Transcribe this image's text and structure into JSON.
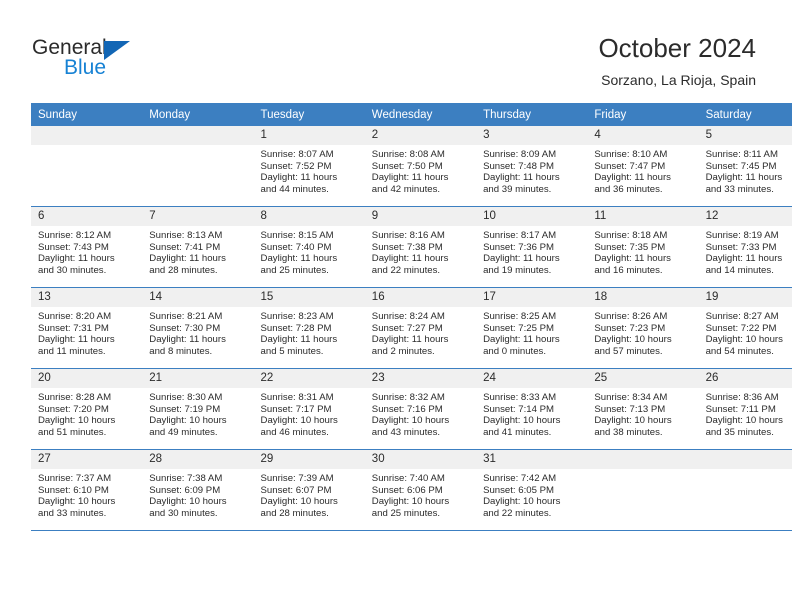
{
  "brand": {
    "name_top": "General",
    "name_bottom": "Blue",
    "accent_color": "#1782d4",
    "triangle_color": "#1266b5"
  },
  "header": {
    "title": "October 2024",
    "subtitle": "Sorzano, La Rioja, Spain"
  },
  "calendar": {
    "header_bg": "#3c7fc1",
    "daynum_bg": "#f0f0f0",
    "weekday_headers": [
      "Sunday",
      "Monday",
      "Tuesday",
      "Wednesday",
      "Thursday",
      "Friday",
      "Saturday"
    ],
    "weeks": [
      [
        {
          "day": "",
          "sunrise": "",
          "sunset": "",
          "daylight": "",
          "daylight2": ""
        },
        {
          "day": "",
          "sunrise": "",
          "sunset": "",
          "daylight": "",
          "daylight2": ""
        },
        {
          "day": "1",
          "sunrise": "Sunrise: 8:07 AM",
          "sunset": "Sunset: 7:52 PM",
          "daylight": "Daylight: 11 hours",
          "daylight2": "and 44 minutes."
        },
        {
          "day": "2",
          "sunrise": "Sunrise: 8:08 AM",
          "sunset": "Sunset: 7:50 PM",
          "daylight": "Daylight: 11 hours",
          "daylight2": "and 42 minutes."
        },
        {
          "day": "3",
          "sunrise": "Sunrise: 8:09 AM",
          "sunset": "Sunset: 7:48 PM",
          "daylight": "Daylight: 11 hours",
          "daylight2": "and 39 minutes."
        },
        {
          "day": "4",
          "sunrise": "Sunrise: 8:10 AM",
          "sunset": "Sunset: 7:47 PM",
          "daylight": "Daylight: 11 hours",
          "daylight2": "and 36 minutes."
        },
        {
          "day": "5",
          "sunrise": "Sunrise: 8:11 AM",
          "sunset": "Sunset: 7:45 PM",
          "daylight": "Daylight: 11 hours",
          "daylight2": "and 33 minutes."
        }
      ],
      [
        {
          "day": "6",
          "sunrise": "Sunrise: 8:12 AM",
          "sunset": "Sunset: 7:43 PM",
          "daylight": "Daylight: 11 hours",
          "daylight2": "and 30 minutes."
        },
        {
          "day": "7",
          "sunrise": "Sunrise: 8:13 AM",
          "sunset": "Sunset: 7:41 PM",
          "daylight": "Daylight: 11 hours",
          "daylight2": "and 28 minutes."
        },
        {
          "day": "8",
          "sunrise": "Sunrise: 8:15 AM",
          "sunset": "Sunset: 7:40 PM",
          "daylight": "Daylight: 11 hours",
          "daylight2": "and 25 minutes."
        },
        {
          "day": "9",
          "sunrise": "Sunrise: 8:16 AM",
          "sunset": "Sunset: 7:38 PM",
          "daylight": "Daylight: 11 hours",
          "daylight2": "and 22 minutes."
        },
        {
          "day": "10",
          "sunrise": "Sunrise: 8:17 AM",
          "sunset": "Sunset: 7:36 PM",
          "daylight": "Daylight: 11 hours",
          "daylight2": "and 19 minutes."
        },
        {
          "day": "11",
          "sunrise": "Sunrise: 8:18 AM",
          "sunset": "Sunset: 7:35 PM",
          "daylight": "Daylight: 11 hours",
          "daylight2": "and 16 minutes."
        },
        {
          "day": "12",
          "sunrise": "Sunrise: 8:19 AM",
          "sunset": "Sunset: 7:33 PM",
          "daylight": "Daylight: 11 hours",
          "daylight2": "and 14 minutes."
        }
      ],
      [
        {
          "day": "13",
          "sunrise": "Sunrise: 8:20 AM",
          "sunset": "Sunset: 7:31 PM",
          "daylight": "Daylight: 11 hours",
          "daylight2": "and 11 minutes."
        },
        {
          "day": "14",
          "sunrise": "Sunrise: 8:21 AM",
          "sunset": "Sunset: 7:30 PM",
          "daylight": "Daylight: 11 hours",
          "daylight2": "and 8 minutes."
        },
        {
          "day": "15",
          "sunrise": "Sunrise: 8:23 AM",
          "sunset": "Sunset: 7:28 PM",
          "daylight": "Daylight: 11 hours",
          "daylight2": "and 5 minutes."
        },
        {
          "day": "16",
          "sunrise": "Sunrise: 8:24 AM",
          "sunset": "Sunset: 7:27 PM",
          "daylight": "Daylight: 11 hours",
          "daylight2": "and 2 minutes."
        },
        {
          "day": "17",
          "sunrise": "Sunrise: 8:25 AM",
          "sunset": "Sunset: 7:25 PM",
          "daylight": "Daylight: 11 hours",
          "daylight2": "and 0 minutes."
        },
        {
          "day": "18",
          "sunrise": "Sunrise: 8:26 AM",
          "sunset": "Sunset: 7:23 PM",
          "daylight": "Daylight: 10 hours",
          "daylight2": "and 57 minutes."
        },
        {
          "day": "19",
          "sunrise": "Sunrise: 8:27 AM",
          "sunset": "Sunset: 7:22 PM",
          "daylight": "Daylight: 10 hours",
          "daylight2": "and 54 minutes."
        }
      ],
      [
        {
          "day": "20",
          "sunrise": "Sunrise: 8:28 AM",
          "sunset": "Sunset: 7:20 PM",
          "daylight": "Daylight: 10 hours",
          "daylight2": "and 51 minutes."
        },
        {
          "day": "21",
          "sunrise": "Sunrise: 8:30 AM",
          "sunset": "Sunset: 7:19 PM",
          "daylight": "Daylight: 10 hours",
          "daylight2": "and 49 minutes."
        },
        {
          "day": "22",
          "sunrise": "Sunrise: 8:31 AM",
          "sunset": "Sunset: 7:17 PM",
          "daylight": "Daylight: 10 hours",
          "daylight2": "and 46 minutes."
        },
        {
          "day": "23",
          "sunrise": "Sunrise: 8:32 AM",
          "sunset": "Sunset: 7:16 PM",
          "daylight": "Daylight: 10 hours",
          "daylight2": "and 43 minutes."
        },
        {
          "day": "24",
          "sunrise": "Sunrise: 8:33 AM",
          "sunset": "Sunset: 7:14 PM",
          "daylight": "Daylight: 10 hours",
          "daylight2": "and 41 minutes."
        },
        {
          "day": "25",
          "sunrise": "Sunrise: 8:34 AM",
          "sunset": "Sunset: 7:13 PM",
          "daylight": "Daylight: 10 hours",
          "daylight2": "and 38 minutes."
        },
        {
          "day": "26",
          "sunrise": "Sunrise: 8:36 AM",
          "sunset": "Sunset: 7:11 PM",
          "daylight": "Daylight: 10 hours",
          "daylight2": "and 35 minutes."
        }
      ],
      [
        {
          "day": "27",
          "sunrise": "Sunrise: 7:37 AM",
          "sunset": "Sunset: 6:10 PM",
          "daylight": "Daylight: 10 hours",
          "daylight2": "and 33 minutes."
        },
        {
          "day": "28",
          "sunrise": "Sunrise: 7:38 AM",
          "sunset": "Sunset: 6:09 PM",
          "daylight": "Daylight: 10 hours",
          "daylight2": "and 30 minutes."
        },
        {
          "day": "29",
          "sunrise": "Sunrise: 7:39 AM",
          "sunset": "Sunset: 6:07 PM",
          "daylight": "Daylight: 10 hours",
          "daylight2": "and 28 minutes."
        },
        {
          "day": "30",
          "sunrise": "Sunrise: 7:40 AM",
          "sunset": "Sunset: 6:06 PM",
          "daylight": "Daylight: 10 hours",
          "daylight2": "and 25 minutes."
        },
        {
          "day": "31",
          "sunrise": "Sunrise: 7:42 AM",
          "sunset": "Sunset: 6:05 PM",
          "daylight": "Daylight: 10 hours",
          "daylight2": "and 22 minutes."
        },
        {
          "day": "",
          "sunrise": "",
          "sunset": "",
          "daylight": "",
          "daylight2": ""
        },
        {
          "day": "",
          "sunrise": "",
          "sunset": "",
          "daylight": "",
          "daylight2": ""
        }
      ]
    ]
  }
}
